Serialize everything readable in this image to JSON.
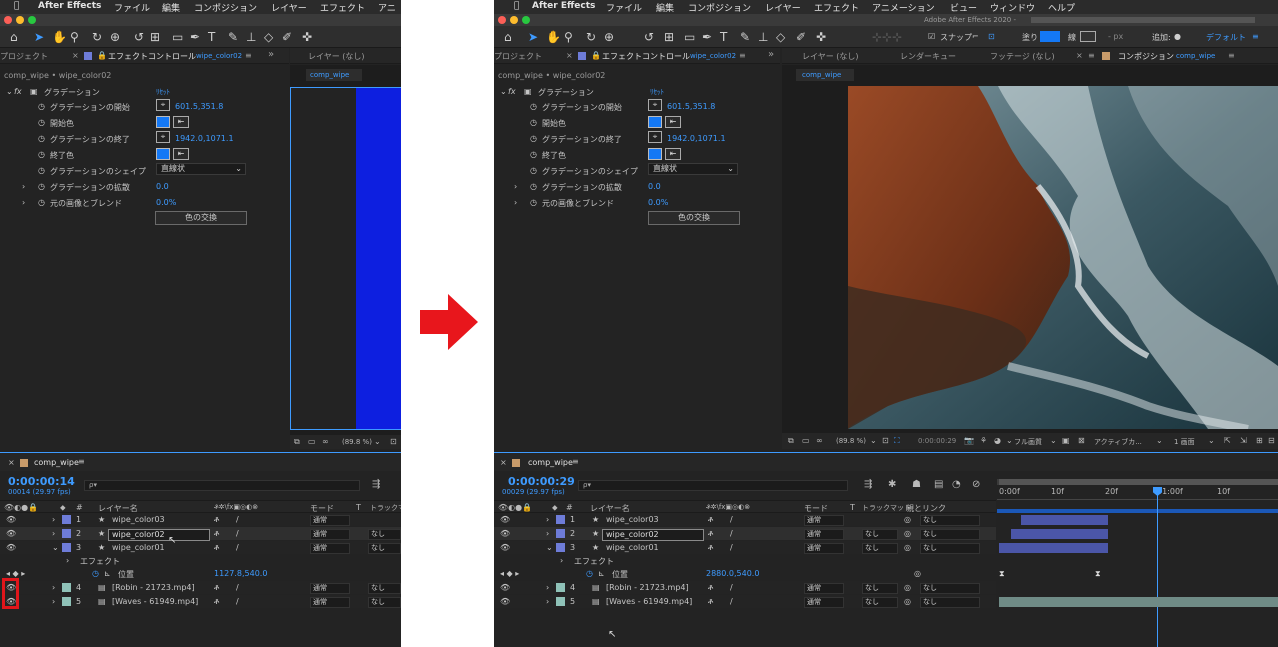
{
  "menu": {
    "apple_icon": "apple-icon",
    "app": "After Effects",
    "items": [
      "ファイル",
      "編集",
      "コンポジション",
      "レイヤー",
      "エフェクト",
      "アニ"
    ],
    "items_right": [
      "ファイル",
      "編集",
      "コンポジション",
      "レイヤー",
      "エフェクト",
      "アニメーション",
      "ビュー",
      "ウィンドウ",
      "ヘルプ"
    ]
  },
  "window_title": "Adobe After Effects 2020 - ",
  "toolbar": {
    "snap": "スナップ",
    "fill": "塗り",
    "stroke": "線",
    "px": "- px",
    "add": "追加:",
    "workspace": "デフォルト"
  },
  "project_tab": "プロジェクト",
  "effect_tab": "エフェクトコントロール",
  "effect_tab_comp": "wipe_color02",
  "breadcrumb": "comp_wipe • wipe_color02",
  "effect": {
    "name": "グラデーション",
    "reset": "ﾘｾｯﾄ",
    "props": [
      {
        "label": "グラデーションの開始",
        "value": "601.5,351.8"
      },
      {
        "label": "開始色"
      },
      {
        "label": "グラデーションの終了",
        "value": "1942.0,1071.1"
      },
      {
        "label": "終了色"
      },
      {
        "label": "グラデーションのシェイプ",
        "value": "直線状"
      },
      {
        "label": "グラデーションの拡散",
        "value": "0.0"
      },
      {
        "label": "元の画像とブレンド",
        "value": "0.0%"
      }
    ],
    "swap_button": "色の交換"
  },
  "viewer_tabs": {
    "layer": "レイヤー (なし)",
    "render": "レンダーキュー",
    "footage": "フッテージ (なし)",
    "comp": "コンポジション",
    "comp_name": "comp_wipe"
  },
  "viewer_bottom": {
    "zoom": "(89.8 %)",
    "time": "0:00:00:29",
    "quality": "フル画質",
    "camera": "アクティブカ...",
    "view": "1 画面"
  },
  "timeline": {
    "tab": "comp_wipe",
    "left": {
      "time": "0:00:00:14",
      "frames": "00014 (29.97 fps)"
    },
    "right": {
      "time": "0:00:00:29",
      "frames": "00029 (29.97 fps)"
    },
    "search_placeholder": "ρ▾",
    "col_num": "#",
    "col_name": "レイヤー名",
    "col_mode": "モード",
    "col_t": "T",
    "col_track": "トラックマット",
    "col_parent": "親とリンク",
    "ruler": [
      "0:00f",
      "10f",
      "20f",
      "01:00f",
      "10f"
    ],
    "layers": [
      {
        "num": "1",
        "name": "wipe_color03",
        "mode": "通常",
        "track": "",
        "parent": "なし",
        "color": "#6e7cd8"
      },
      {
        "num": "2",
        "name": "wipe_color02",
        "mode": "通常",
        "track": "なし",
        "parent": "なし",
        "color": "#6e7cd8"
      },
      {
        "num": "3",
        "name": "wipe_color01",
        "mode": "通常",
        "track": "なし",
        "parent": "なし",
        "color": "#6e7cd8"
      },
      {
        "num": "4",
        "name": "[Robin - 21723.mp4]",
        "mode": "通常",
        "track": "なし",
        "parent": "なし",
        "color": "#8fc2b8"
      },
      {
        "num": "5",
        "name": "[Waves - 61949.mp4]",
        "mode": "通常",
        "track": "なし",
        "parent": "なし",
        "color": "#8fc2b8"
      }
    ],
    "effect_label": "エフェクト",
    "position_label": "位置",
    "position_left": "1127.8,540.0",
    "position_right": "2880.0,540.0"
  },
  "colors": {
    "accent": "#3e9bff",
    "panel": "#232323",
    "solid_blue": "#0d1fe0",
    "red_highlight": "#e0161b",
    "arrow": "#e8161c"
  }
}
